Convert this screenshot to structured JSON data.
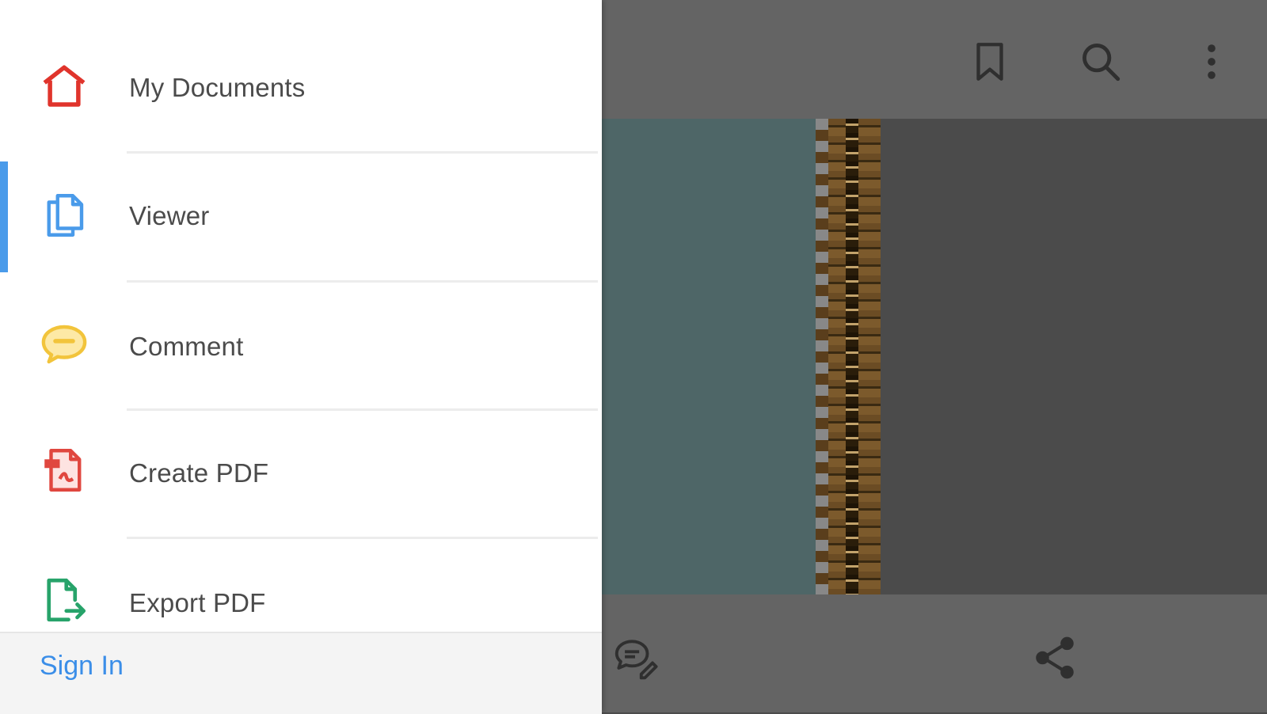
{
  "drawer": {
    "items": [
      {
        "label": "My Documents",
        "icon": "home-icon",
        "color": "#e0342c",
        "active": false
      },
      {
        "label": "Viewer",
        "icon": "documents-icon",
        "color": "#4a9bea",
        "active": true
      },
      {
        "label": "Comment",
        "icon": "comment-bubble-icon",
        "color": "#f2c43b",
        "active": false
      },
      {
        "label": "Create PDF",
        "icon": "create-pdf-icon",
        "color": "#e0473f",
        "active": false
      },
      {
        "label": "Export PDF",
        "icon": "export-pdf-icon",
        "color": "#27a36a",
        "active": false
      }
    ],
    "sign_in_label": "Sign In",
    "active_color": "#4a9bea"
  },
  "viewer": {
    "toolbar_icons": [
      "bookmark-icon",
      "search-icon",
      "more-vertical-icon"
    ],
    "bottom_icons": [
      "comment-edit-icon",
      "share-icon"
    ]
  }
}
